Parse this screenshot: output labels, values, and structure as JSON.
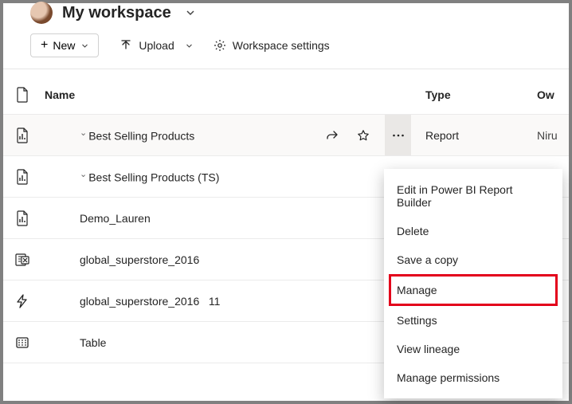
{
  "header": {
    "title": "My workspace"
  },
  "toolbar": {
    "new_label": "New",
    "upload_label": "Upload",
    "settings_label": "Workspace settings"
  },
  "table": {
    "headers": {
      "name": "Name",
      "type": "Type",
      "owner": "Ow"
    },
    "rows": [
      {
        "name": "Best Selling Products",
        "type": "Report",
        "owner": "Niru"
      },
      {
        "name": "Best Selling Products (TS)"
      },
      {
        "name": "Demo_Lauren"
      },
      {
        "name": "global_superstore_2016"
      },
      {
        "name": "global_superstore_2016",
        "count": "11"
      },
      {
        "name": "Table"
      }
    ]
  },
  "menu": {
    "items": [
      "Edit in Power BI Report Builder",
      "Delete",
      "Save a copy",
      "Manage",
      "Settings",
      "View lineage",
      "Manage permissions"
    ]
  }
}
